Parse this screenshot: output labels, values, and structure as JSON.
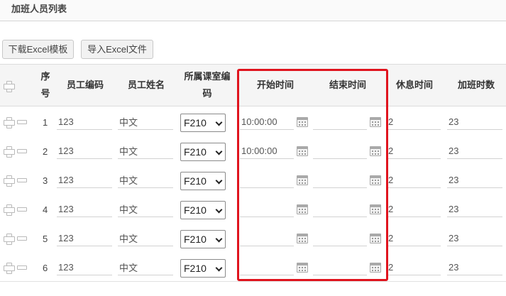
{
  "panel": {
    "title": "加班人员列表"
  },
  "toolbar": {
    "download_label": "下载Excel模板",
    "import_label": "导入Excel文件"
  },
  "columns": {
    "seq": "序号",
    "emp_code": "员工编码",
    "emp_name": "员工姓名",
    "room_code": "所属课室编码",
    "start_time": "开始时间",
    "end_time": "结束时间",
    "rest_time": "休息时间",
    "ot_hours": "加班时数"
  },
  "rows": [
    {
      "idx": "1",
      "emp_code": "123",
      "emp_name": "中文",
      "room": "F210",
      "start": "10:00:00",
      "end": "",
      "rest": "2",
      "hours": "23"
    },
    {
      "idx": "2",
      "emp_code": "123",
      "emp_name": "中文",
      "room": "F210",
      "start": "10:00:00",
      "end": "",
      "rest": "2",
      "hours": "23"
    },
    {
      "idx": "3",
      "emp_code": "123",
      "emp_name": "中文",
      "room": "F210",
      "start": "",
      "end": "",
      "rest": "2",
      "hours": "23"
    },
    {
      "idx": "4",
      "emp_code": "123",
      "emp_name": "中文",
      "room": "F210",
      "start": "",
      "end": "",
      "rest": "2",
      "hours": "23"
    },
    {
      "idx": "5",
      "emp_code": "123",
      "emp_name": "中文",
      "room": "F210",
      "start": "",
      "end": "",
      "rest": "2",
      "hours": "23"
    },
    {
      "idx": "6",
      "emp_code": "123",
      "emp_name": "中文",
      "room": "F210",
      "start": "",
      "end": "",
      "rest": "2",
      "hours": "23"
    }
  ],
  "colors": {
    "highlight": "#e0141e",
    "header_bg": "#f5f5f5"
  }
}
